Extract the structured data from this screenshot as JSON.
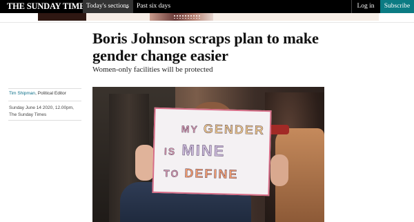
{
  "nav": {
    "brand": "THE SUNDAY TIMES",
    "todays_sections": "Today's sections",
    "past_six_days": "Past six days",
    "login": "Log in",
    "subscribe": "Subscribe",
    "chevron_icon": "chevron-down-icon",
    "subscribe_color": "#0b7b83"
  },
  "article": {
    "headline": "Boris Johnson scraps plan to make gender change easier",
    "standfirst": "Women-only facilities will be protected",
    "author": "Tim Shipman",
    "author_role": ", Political Editor",
    "date": "Sunday June 14 2020, 12.00pm,",
    "publication": "The Sunday Times"
  },
  "photo": {
    "sign_line1_a": "MY",
    "sign_line1_b": "GENDER",
    "sign_line2_a": "IS",
    "sign_line2_b": "MINE",
    "sign_line3_a": "TO",
    "sign_line3_b": "DEFINE"
  }
}
